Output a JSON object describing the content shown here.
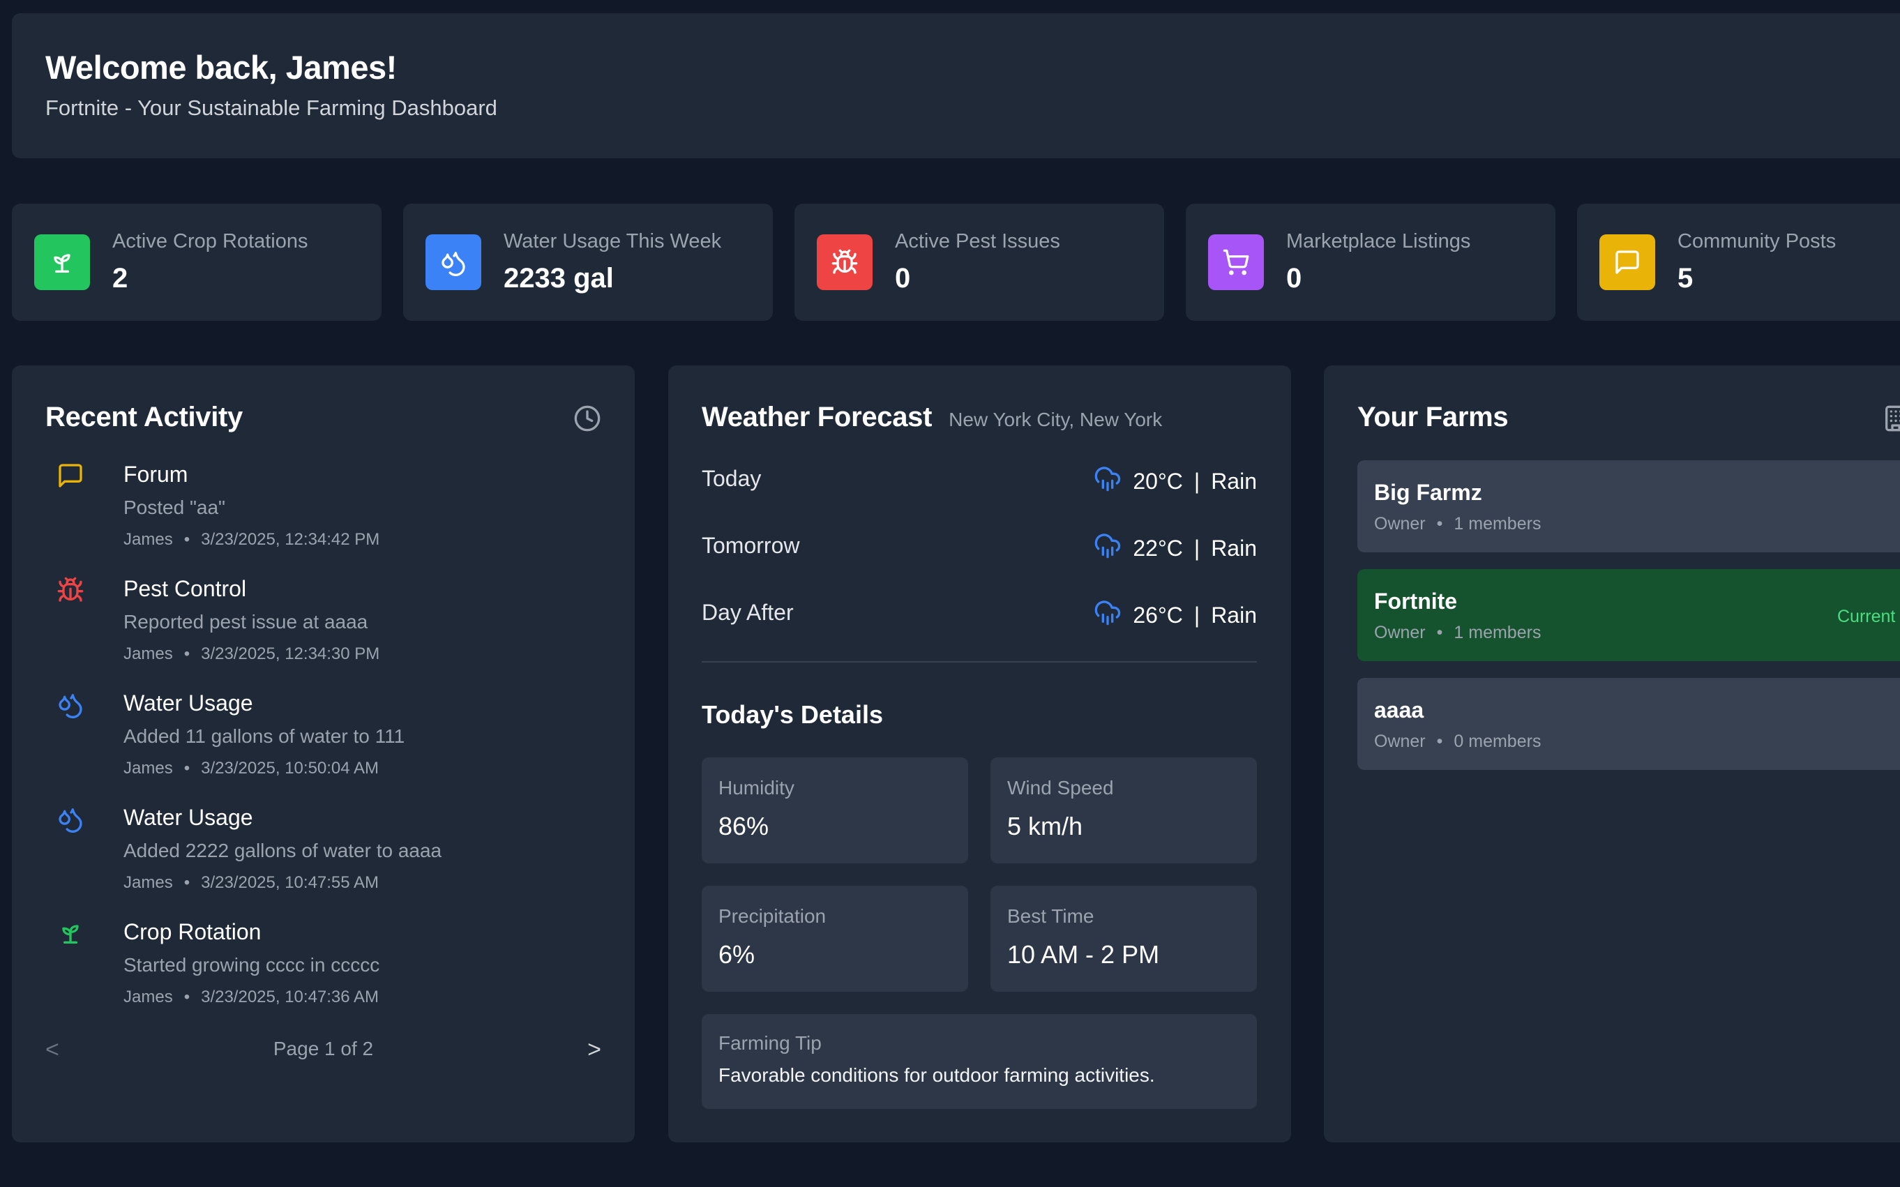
{
  "header": {
    "welcome": "Welcome back, James!",
    "subtitle": "Fortnite - Your Sustainable Farming Dashboard"
  },
  "stats": [
    {
      "label": "Active Crop Rotations",
      "value": "2",
      "icon": "sprout-icon",
      "color": "#22c55e"
    },
    {
      "label": "Water Usage This Week",
      "value": "2233 gal",
      "icon": "droplets-icon",
      "color": "#3b82f6"
    },
    {
      "label": "Active Pest Issues",
      "value": "0",
      "icon": "bug-icon",
      "color": "#ef4444"
    },
    {
      "label": "Marketplace Listings",
      "value": "0",
      "icon": "cart-icon",
      "color": "#a855f7"
    },
    {
      "label": "Community Posts",
      "value": "5",
      "icon": "message-square-icon",
      "color": "#eab308"
    }
  ],
  "activity": {
    "title": "Recent Activity",
    "icon": "clock-icon",
    "items": [
      {
        "type": "Forum",
        "desc": "Posted \"aa\"",
        "user": "James",
        "time": "3/23/2025, 12:34:42 PM",
        "icon": "message-square-icon",
        "color": "#eab308"
      },
      {
        "type": "Pest Control",
        "desc": "Reported pest issue at aaaa",
        "user": "James",
        "time": "3/23/2025, 12:34:30 PM",
        "icon": "bug-icon",
        "color": "#ef4444"
      },
      {
        "type": "Water Usage",
        "desc": "Added 11 gallons of water to 111",
        "user": "James",
        "time": "3/23/2025, 10:50:04 AM",
        "icon": "droplets-icon",
        "color": "#3b82f6"
      },
      {
        "type": "Water Usage",
        "desc": "Added 2222 gallons of water to aaaa",
        "user": "James",
        "time": "3/23/2025, 10:47:55 AM",
        "icon": "droplets-icon",
        "color": "#3b82f6"
      },
      {
        "type": "Crop Rotation",
        "desc": "Started growing cccc in ccccc",
        "user": "James",
        "time": "3/23/2025, 10:47:36 AM",
        "icon": "sprout-icon",
        "color": "#22c55e"
      }
    ],
    "pagination": {
      "prev": "<",
      "label": "Page 1 of 2",
      "next": ">"
    },
    "separator": "•"
  },
  "weather": {
    "title": "Weather Forecast",
    "location": "New York City, New York",
    "forecast": [
      {
        "day": "Today",
        "temp": "20°C",
        "sep": "|",
        "cond": "Rain",
        "icon": "cloud-rain-icon"
      },
      {
        "day": "Tomorrow",
        "temp": "22°C",
        "sep": "|",
        "cond": "Rain",
        "icon": "cloud-rain-icon"
      },
      {
        "day": "Day After",
        "temp": "26°C",
        "sep": "|",
        "cond": "Rain",
        "icon": "cloud-rain-icon"
      }
    ],
    "details_title": "Today's Details",
    "details": [
      {
        "label": "Humidity",
        "value": "86%"
      },
      {
        "label": "Wind Speed",
        "value": "5 km/h"
      },
      {
        "label": "Precipitation",
        "value": "6%"
      },
      {
        "label": "Best Time",
        "value": "10 AM - 2 PM"
      }
    ],
    "tip": {
      "label": "Farming Tip",
      "text": "Favorable conditions for outdoor farming activities."
    }
  },
  "farms": {
    "title": "Your Farms",
    "icon": "building-icon",
    "items": [
      {
        "name": "Big Farmz",
        "role": "Owner",
        "members": "1 members",
        "current": ""
      },
      {
        "name": "Fortnite",
        "role": "Owner",
        "members": "1 members",
        "current": "Current"
      },
      {
        "name": "aaaa",
        "role": "Owner",
        "members": "0 members",
        "current": ""
      }
    ],
    "separator": "•"
  },
  "colors": {
    "background": "#111827",
    "card": "#1f2937",
    "inner": "#374151",
    "current_farm": "#14532d",
    "accent_green": "#4ade80"
  }
}
